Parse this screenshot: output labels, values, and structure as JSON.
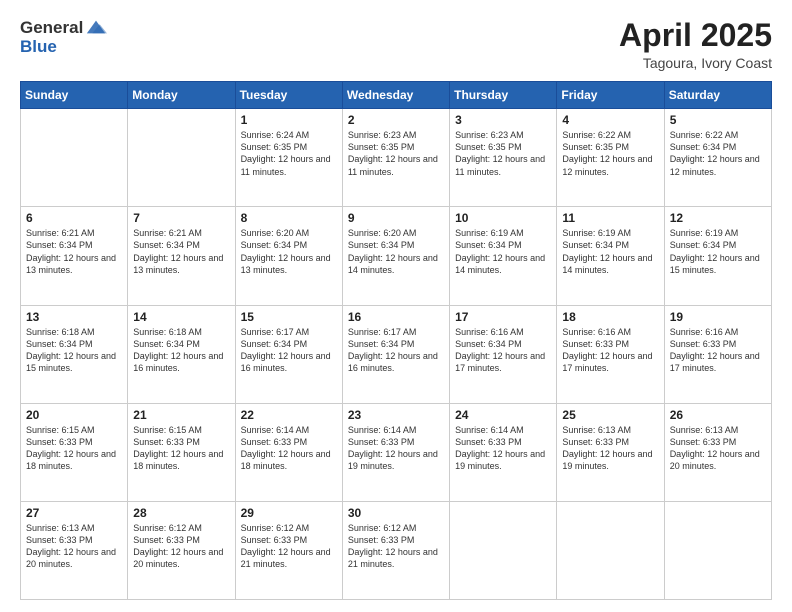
{
  "logo": {
    "general": "General",
    "blue": "Blue"
  },
  "title": "April 2025",
  "subtitle": "Tagoura, Ivory Coast",
  "days_of_week": [
    "Sunday",
    "Monday",
    "Tuesday",
    "Wednesday",
    "Thursday",
    "Friday",
    "Saturday"
  ],
  "weeks": [
    [
      {
        "day": "",
        "info": ""
      },
      {
        "day": "",
        "info": ""
      },
      {
        "day": "1",
        "info": "Sunrise: 6:24 AM\nSunset: 6:35 PM\nDaylight: 12 hours and 11 minutes."
      },
      {
        "day": "2",
        "info": "Sunrise: 6:23 AM\nSunset: 6:35 PM\nDaylight: 12 hours and 11 minutes."
      },
      {
        "day": "3",
        "info": "Sunrise: 6:23 AM\nSunset: 6:35 PM\nDaylight: 12 hours and 11 minutes."
      },
      {
        "day": "4",
        "info": "Sunrise: 6:22 AM\nSunset: 6:35 PM\nDaylight: 12 hours and 12 minutes."
      },
      {
        "day": "5",
        "info": "Sunrise: 6:22 AM\nSunset: 6:34 PM\nDaylight: 12 hours and 12 minutes."
      }
    ],
    [
      {
        "day": "6",
        "info": "Sunrise: 6:21 AM\nSunset: 6:34 PM\nDaylight: 12 hours and 13 minutes."
      },
      {
        "day": "7",
        "info": "Sunrise: 6:21 AM\nSunset: 6:34 PM\nDaylight: 12 hours and 13 minutes."
      },
      {
        "day": "8",
        "info": "Sunrise: 6:20 AM\nSunset: 6:34 PM\nDaylight: 12 hours and 13 minutes."
      },
      {
        "day": "9",
        "info": "Sunrise: 6:20 AM\nSunset: 6:34 PM\nDaylight: 12 hours and 14 minutes."
      },
      {
        "day": "10",
        "info": "Sunrise: 6:19 AM\nSunset: 6:34 PM\nDaylight: 12 hours and 14 minutes."
      },
      {
        "day": "11",
        "info": "Sunrise: 6:19 AM\nSunset: 6:34 PM\nDaylight: 12 hours and 14 minutes."
      },
      {
        "day": "12",
        "info": "Sunrise: 6:19 AM\nSunset: 6:34 PM\nDaylight: 12 hours and 15 minutes."
      }
    ],
    [
      {
        "day": "13",
        "info": "Sunrise: 6:18 AM\nSunset: 6:34 PM\nDaylight: 12 hours and 15 minutes."
      },
      {
        "day": "14",
        "info": "Sunrise: 6:18 AM\nSunset: 6:34 PM\nDaylight: 12 hours and 16 minutes."
      },
      {
        "day": "15",
        "info": "Sunrise: 6:17 AM\nSunset: 6:34 PM\nDaylight: 12 hours and 16 minutes."
      },
      {
        "day": "16",
        "info": "Sunrise: 6:17 AM\nSunset: 6:34 PM\nDaylight: 12 hours and 16 minutes."
      },
      {
        "day": "17",
        "info": "Sunrise: 6:16 AM\nSunset: 6:34 PM\nDaylight: 12 hours and 17 minutes."
      },
      {
        "day": "18",
        "info": "Sunrise: 6:16 AM\nSunset: 6:33 PM\nDaylight: 12 hours and 17 minutes."
      },
      {
        "day": "19",
        "info": "Sunrise: 6:16 AM\nSunset: 6:33 PM\nDaylight: 12 hours and 17 minutes."
      }
    ],
    [
      {
        "day": "20",
        "info": "Sunrise: 6:15 AM\nSunset: 6:33 PM\nDaylight: 12 hours and 18 minutes."
      },
      {
        "day": "21",
        "info": "Sunrise: 6:15 AM\nSunset: 6:33 PM\nDaylight: 12 hours and 18 minutes."
      },
      {
        "day": "22",
        "info": "Sunrise: 6:14 AM\nSunset: 6:33 PM\nDaylight: 12 hours and 18 minutes."
      },
      {
        "day": "23",
        "info": "Sunrise: 6:14 AM\nSunset: 6:33 PM\nDaylight: 12 hours and 19 minutes."
      },
      {
        "day": "24",
        "info": "Sunrise: 6:14 AM\nSunset: 6:33 PM\nDaylight: 12 hours and 19 minutes."
      },
      {
        "day": "25",
        "info": "Sunrise: 6:13 AM\nSunset: 6:33 PM\nDaylight: 12 hours and 19 minutes."
      },
      {
        "day": "26",
        "info": "Sunrise: 6:13 AM\nSunset: 6:33 PM\nDaylight: 12 hours and 20 minutes."
      }
    ],
    [
      {
        "day": "27",
        "info": "Sunrise: 6:13 AM\nSunset: 6:33 PM\nDaylight: 12 hours and 20 minutes."
      },
      {
        "day": "28",
        "info": "Sunrise: 6:12 AM\nSunset: 6:33 PM\nDaylight: 12 hours and 20 minutes."
      },
      {
        "day": "29",
        "info": "Sunrise: 6:12 AM\nSunset: 6:33 PM\nDaylight: 12 hours and 21 minutes."
      },
      {
        "day": "30",
        "info": "Sunrise: 6:12 AM\nSunset: 6:33 PM\nDaylight: 12 hours and 21 minutes."
      },
      {
        "day": "",
        "info": ""
      },
      {
        "day": "",
        "info": ""
      },
      {
        "day": "",
        "info": ""
      }
    ]
  ]
}
